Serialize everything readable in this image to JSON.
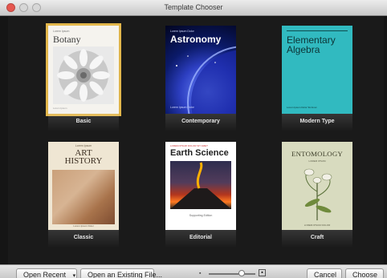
{
  "window": {
    "title": "Template Chooser",
    "controls": {
      "close": "close-icon",
      "minimize": "minimize-icon",
      "zoom": "zoom-icon"
    }
  },
  "templates": [
    {
      "label": "Basic",
      "selected": true,
      "cover": {
        "small": "Lorem Ipsum",
        "title": "Botany",
        "footer": "Lorem Ipsum"
      }
    },
    {
      "label": "Contemporary",
      "selected": false,
      "cover": {
        "small": "Lorem Ipsum Dolor",
        "title": "Astronomy",
        "footer": "Lorem Ipsum Dolor"
      }
    },
    {
      "label": "Modern Type",
      "selected": false,
      "cover": {
        "title_line1": "Elementary",
        "title_line2": "Algebra",
        "footer": "Lorem Ipsum Dolor Sit Amet"
      }
    },
    {
      "label": "Classic",
      "selected": false,
      "cover": {
        "small": "Lorem Ipsum",
        "title_line1": "ART",
        "title_line2": "HISTORY",
        "footer": "Lorem Ipsum Dolor"
      }
    },
    {
      "label": "Editorial",
      "selected": false,
      "cover": {
        "small": "LOREM IPSUM DOLOR SIT AMET",
        "title": "Earth Science",
        "footer": "Supporting Edition"
      }
    },
    {
      "label": "Craft",
      "selected": false,
      "cover": {
        "title": "ENTOMOLOGY",
        "small": "LOREM IPSUM",
        "footer": "LOREM IPSUM DOLOR"
      }
    }
  ],
  "footer": {
    "open_recent": "Open Recent",
    "open_existing": "Open an Existing File...",
    "cancel": "Cancel",
    "choose": "Choose",
    "slider": {
      "value": 0.7
    }
  }
}
